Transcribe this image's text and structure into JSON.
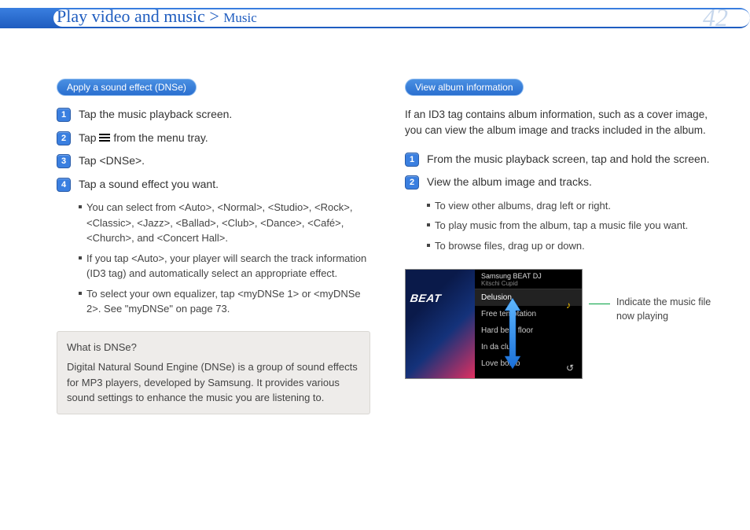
{
  "header": {
    "breadcrumb_main": "Play video and music",
    "breadcrumb_sep": ">",
    "breadcrumb_sub": "Music",
    "page_number": "42"
  },
  "left": {
    "pill": "Apply a sound effect (DNSe)",
    "steps": {
      "s1": "Tap the music playback screen.",
      "s2_pre": "Tap ",
      "s2_post": " from the menu tray.",
      "s3": "Tap <DNSe>.",
      "s4": "Tap a sound effect you want."
    },
    "bullets": {
      "b1": "You can select from <Auto>, <Normal>, <Studio>, <Rock>, <Classic>, <Jazz>, <Ballad>, <Club>, <Dance>, <Café>, <Church>, and <Concert Hall>.",
      "b2": "If you tap <Auto>, your player will search the track information (ID3 tag) and automatically select an appropriate effect.",
      "b3": "To select your own equalizer, tap <myDNSe 1> or <myDNSe 2>. See \"myDNSe\" on page 73."
    },
    "info_title": "What is DNSe?",
    "info_body": "Digital Natural Sound Engine (DNSe) is a group of sound effects for MP3 players, developed by Samsung. It provides various sound settings to enhance the music you are listening to."
  },
  "right": {
    "pill": "View album information",
    "intro": "If an ID3 tag contains album information, such as a cover image, you can view the album image and tracks included in the album.",
    "steps": {
      "s1": "From the music playback screen, tap and hold the screen.",
      "s2": "View the album image and tracks."
    },
    "bullets": {
      "b1": "To view other albums, drag left or right.",
      "b2": "To play music from the album, tap a music file you want.",
      "b3": "To browse files, drag up or down."
    },
    "device": {
      "album_brand": "BEAT",
      "header_line1": "Samsung BEAT DJ",
      "header_line2": "Kitschi Cupid",
      "tracks": [
        "Delusion",
        "Free temptation",
        "Hard beat floor",
        "In da club",
        "Love bomb"
      ]
    },
    "callout": "Indicate the music file now playing"
  }
}
